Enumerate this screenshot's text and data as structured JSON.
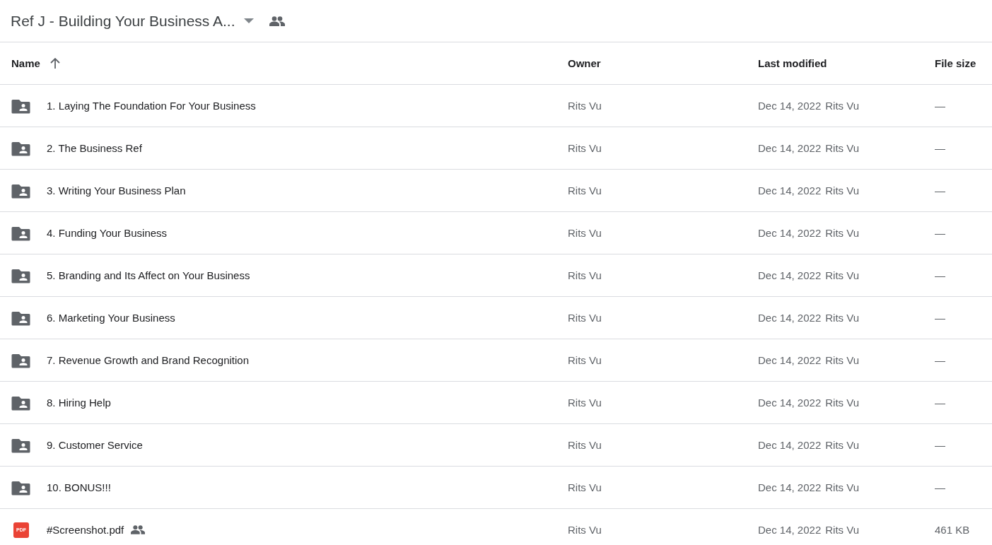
{
  "header": {
    "title": "Ref J - Building Your Business A...",
    "shared": true
  },
  "table": {
    "columns": [
      {
        "label": "Name",
        "sort_ascending": true
      },
      {
        "label": "Owner"
      },
      {
        "label": "Last modified"
      },
      {
        "label": "File size"
      }
    ],
    "rows": [
      {
        "kind": "folder",
        "name": "1. Laying The Foundation For Your Business",
        "shared": false,
        "owner": "Rits Vu",
        "modified": "Dec 14, 2022",
        "modified_by": "Rits Vu",
        "size": "—"
      },
      {
        "kind": "folder",
        "name": "2. The Business Ref",
        "shared": false,
        "owner": "Rits Vu",
        "modified": "Dec 14, 2022",
        "modified_by": "Rits Vu",
        "size": "—"
      },
      {
        "kind": "folder",
        "name": "3. Writing Your Business Plan",
        "shared": false,
        "owner": "Rits Vu",
        "modified": "Dec 14, 2022",
        "modified_by": "Rits Vu",
        "size": "—"
      },
      {
        "kind": "folder",
        "name": "4. Funding Your Business",
        "shared": false,
        "owner": "Rits Vu",
        "modified": "Dec 14, 2022",
        "modified_by": "Rits Vu",
        "size": "—"
      },
      {
        "kind": "folder",
        "name": "5. Branding and Its Affect on Your Business",
        "shared": false,
        "owner": "Rits Vu",
        "modified": "Dec 14, 2022",
        "modified_by": "Rits Vu",
        "size": "—"
      },
      {
        "kind": "folder",
        "name": "6. Marketing Your Business",
        "shared": false,
        "owner": "Rits Vu",
        "modified": "Dec 14, 2022",
        "modified_by": "Rits Vu",
        "size": "—"
      },
      {
        "kind": "folder",
        "name": "7. Revenue Growth and Brand Recognition",
        "shared": false,
        "owner": "Rits Vu",
        "modified": "Dec 14, 2022",
        "modified_by": "Rits Vu",
        "size": "—"
      },
      {
        "kind": "folder",
        "name": "8. Hiring Help",
        "shared": false,
        "owner": "Rits Vu",
        "modified": "Dec 14, 2022",
        "modified_by": "Rits Vu",
        "size": "—"
      },
      {
        "kind": "folder",
        "name": "9. Customer Service",
        "shared": false,
        "owner": "Rits Vu",
        "modified": "Dec 14, 2022",
        "modified_by": "Rits Vu",
        "size": "—"
      },
      {
        "kind": "folder",
        "name": "10. BONUS!!!",
        "shared": false,
        "owner": "Rits Vu",
        "modified": "Dec 14, 2022",
        "modified_by": "Rits Vu",
        "size": "—"
      },
      {
        "kind": "pdf",
        "icon_label": "PDF",
        "name": "#Screenshot.pdf",
        "shared": true,
        "owner": "Rits Vu",
        "modified": "Dec 14, 2022",
        "modified_by": "Rits Vu",
        "size": "461 KB"
      }
    ]
  }
}
